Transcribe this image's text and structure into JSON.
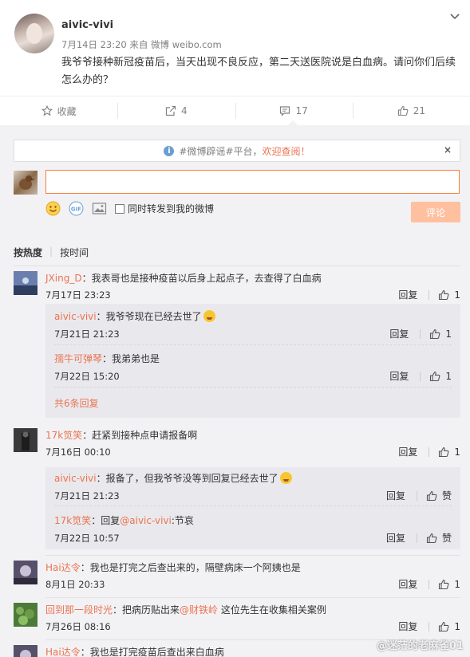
{
  "post": {
    "author": "aivic-vivi",
    "meta": "7月14日 23:20 来自 微博 weibo.com",
    "text": "我爷爷接种新冠疫苗后，当天出现不良反应，第二天送医院说是白血病。请问你们后续怎么办的？"
  },
  "actions": {
    "favorite": "收藏",
    "forward": "4",
    "comment": "17",
    "like": "21"
  },
  "notice": {
    "prefix": "#微博辟谣#平台，",
    "highlight": "欢迎查阅！",
    "close": "×"
  },
  "composer": {
    "checkbox_label": "同时转发到我的微博",
    "submit": "评论"
  },
  "sort": {
    "hot": "按热度",
    "time": "按时间"
  },
  "labels": {
    "reply": "回复",
    "like_text": "赞"
  },
  "comments": [
    {
      "user": "JXing_D",
      "text": "：我表哥也是接种疫苗以后身上起点子，去查得了白血病",
      "time": "7月17日 23:23",
      "likes": "1",
      "replies": [
        {
          "user": "aivic-vivi",
          "text": "：我爷爷现在已经去世了",
          "time": "7月21日 21:23",
          "likes": "1"
        },
        {
          "user": "孺牛可弹琴",
          "text": "：我弟弟也是",
          "time": "7月22日 15:20",
          "likes": "1"
        }
      ],
      "more": "共6条回复"
    },
    {
      "user": "17k笕笑",
      "text": "：赶紧到接种点申请报备啊",
      "time": "7月16日 00:10",
      "likes": "1",
      "replies": [
        {
          "user": "aivic-vivi",
          "text": "：报备了，但我爷爷没等到回复已经去世了",
          "time": "7月21日 21:23",
          "likes": "赞"
        },
        {
          "user": "17k笕笑",
          "text_prefix": "：回复",
          "mention": "@aivic-vivi",
          "text": ":节哀",
          "time": "7月22日 10:57",
          "likes": "赞"
        }
      ]
    },
    {
      "user": "Hai达令",
      "text": "：我也是打完之后查出来的，隔壁病床一个阿姨也是",
      "time": "8月1日 20:33",
      "likes": "1"
    },
    {
      "user": "回到那一段时光",
      "text_prefix": "：把病历贴出来",
      "mention": "@财铁岭",
      "text": " 这位先生在收集相关案例",
      "time": "7月26日 08:16",
      "likes": "1"
    },
    {
      "user": "Hai达令",
      "text": "：我也是打完疫苗后查出来白血病"
    }
  ],
  "watermark": "@迷茫的老麻雀01",
  "colors": {
    "link": "#eb7350",
    "comment_bg": "#f2f2f5",
    "reply_bg": "#e9e9ed",
    "submit_bg": "#ffc09f",
    "input_border": "#fa7d3c"
  }
}
